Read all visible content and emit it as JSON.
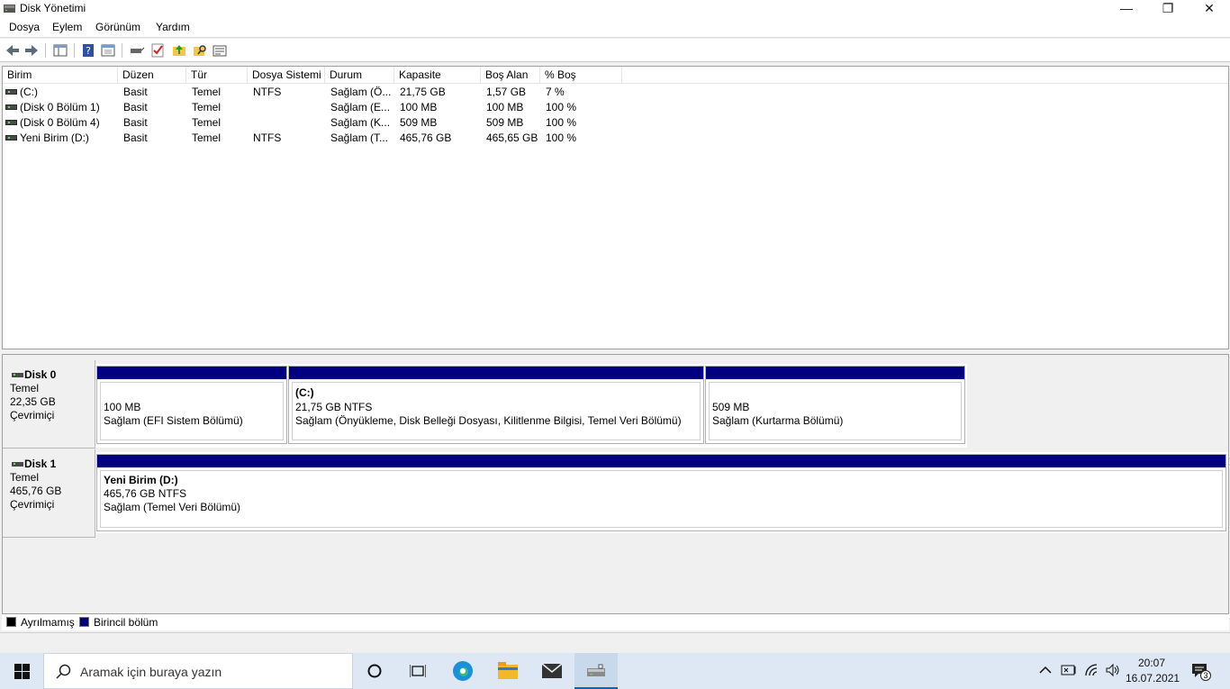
{
  "window": {
    "title": "Disk Yönetimi",
    "controls": [
      "—",
      "❐",
      "✕"
    ]
  },
  "menu": [
    "Dosya",
    "Eylem",
    "Görünüm",
    "Yardım"
  ],
  "columns": [
    "Birim",
    "Düzen",
    "Tür",
    "Dosya Sistemi",
    "Durum",
    "Kapasite",
    "Boş Alan",
    "% Boş"
  ],
  "volumes": [
    {
      "name": " (C:)",
      "layout": "Basit",
      "type": "Temel",
      "fs": "NTFS",
      "status": "Sağlam (Ö...",
      "capacity": "21,75 GB",
      "free": "1,57 GB",
      "pct": "7 %"
    },
    {
      "name": "(Disk 0 Bölüm 1)",
      "layout": "Basit",
      "type": "Temel",
      "fs": "",
      "status": "Sağlam (E...",
      "capacity": "100 MB",
      "free": "100 MB",
      "pct": "100 %"
    },
    {
      "name": "(Disk 0 Bölüm 4)",
      "layout": "Basit",
      "type": "Temel",
      "fs": "",
      "status": "Sağlam (K...",
      "capacity": "509 MB",
      "free": "509 MB",
      "pct": "100 %"
    },
    {
      "name": "Yeni Birim (D:)",
      "layout": "Basit",
      "type": "Temel",
      "fs": "NTFS",
      "status": "Sağlam (T...",
      "capacity": "465,76 GB",
      "free": "465,65 GB",
      "pct": "100 %"
    }
  ],
  "disks": [
    {
      "name": "Disk 0",
      "type": "Temel",
      "size": "22,35 GB",
      "state": "Çevrimiçi",
      "partitions": [
        {
          "title": "",
          "line1": "100 MB",
          "line2": "Sağlam (EFI Sistem Bölümü)"
        },
        {
          "title": " (C:)",
          "line1": "21,75 GB NTFS",
          "line2": "Sağlam (Önyükleme, Disk Belleği Dosyası, Kilitlenme Bilgisi, Temel Veri Bölümü)"
        },
        {
          "title": "",
          "line1": "509 MB",
          "line2": "Sağlam (Kurtarma Bölümü)"
        }
      ]
    },
    {
      "name": "Disk 1",
      "type": "Temel",
      "size": "465,76 GB",
      "state": "Çevrimiçi",
      "partitions": [
        {
          "title": "Yeni Birim  (D:)",
          "line1": "465,76 GB NTFS",
          "line2": "Sağlam (Temel Veri Bölümü)"
        }
      ]
    }
  ],
  "legend": [
    {
      "label": "Ayrılmamış",
      "color": "#000000"
    },
    {
      "label": "Birincil bölüm",
      "color": "#000080"
    }
  ],
  "taskbar": {
    "search_placeholder": "Aramak için buraya yazın",
    "time": "20:07",
    "date": "16.07.2021",
    "notification_count": "3"
  }
}
